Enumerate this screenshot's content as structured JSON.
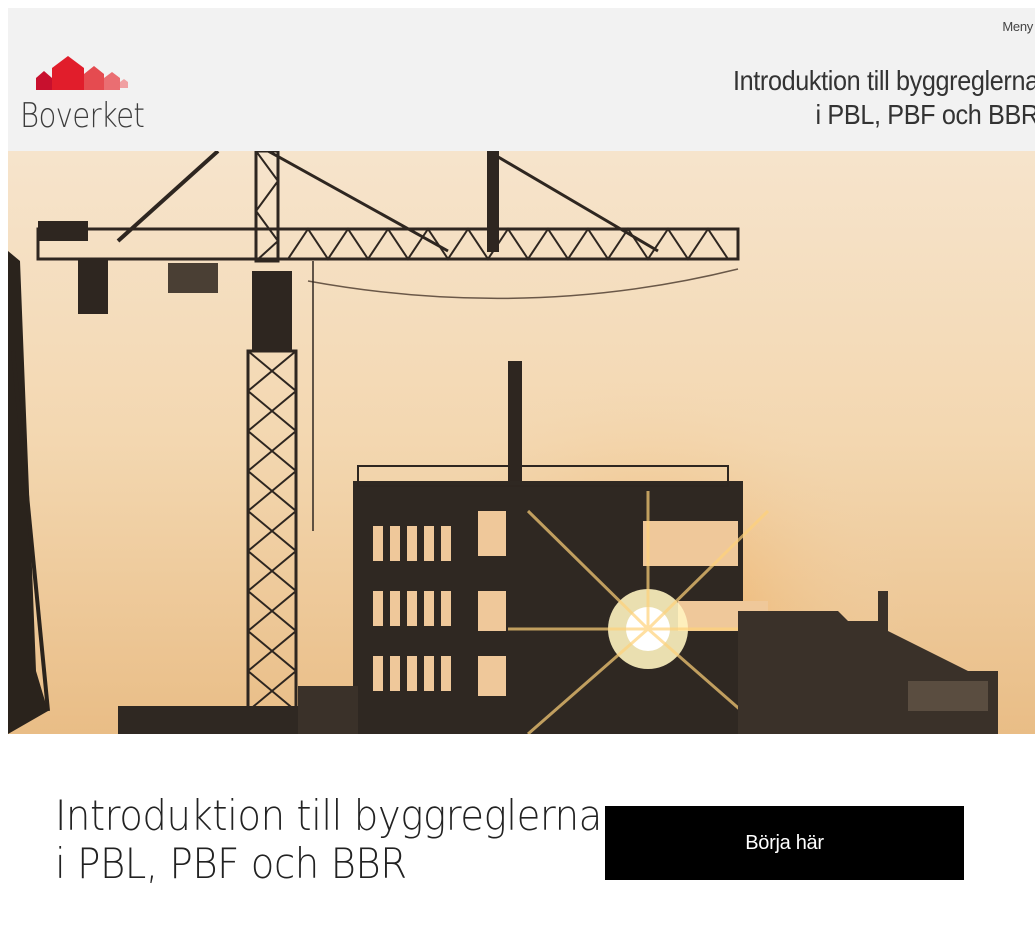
{
  "header": {
    "menu_label": "Meny",
    "logo_text": "Boverket",
    "logo_icon": "boverket-houses-logo",
    "title_line1": "Introduktion till byggreglerna",
    "title_line2": "i PBL, PBF och BBR"
  },
  "hero": {
    "image": "construction-site-cranes-sunset-photo"
  },
  "intro": {
    "title_line1": "Introduktion till byggreglerna",
    "title_line2": "i PBL, PBF och BBR",
    "start_button_label": "Börja här"
  },
  "colors": {
    "brand_red": "#d8232a",
    "header_bg": "#f2f2f2",
    "button_bg": "#000000"
  }
}
